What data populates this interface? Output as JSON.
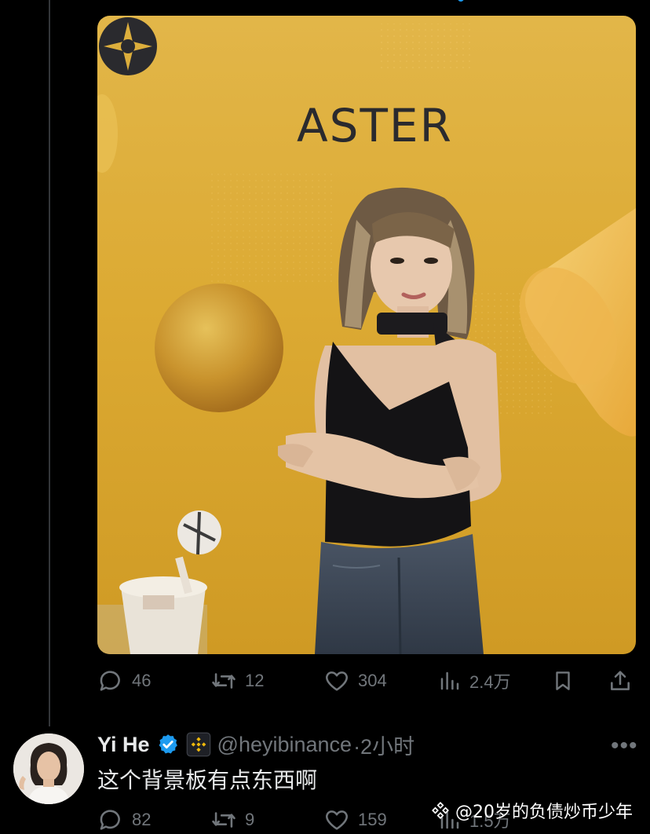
{
  "post": {
    "image_brand_text": "ASTER",
    "stats": {
      "replies": "46",
      "reposts": "12",
      "likes": "304",
      "views": "2.4万"
    }
  },
  "reply": {
    "name": "Yi He",
    "handle": "@heyibinance",
    "time": "·2小时",
    "text": "这个背景板有点东西啊",
    "stats": {
      "replies": "82",
      "reposts": "9",
      "likes": "159",
      "views": "1.5万"
    }
  },
  "watermark": "@20岁的负债炒币少年",
  "colors": {
    "background": "#000000",
    "muted": "#71767b",
    "text": "#e7e9ea",
    "verified": "#1d9bf0",
    "binance": "#f0b90b"
  },
  "icons": [
    "reply-icon",
    "repost-icon",
    "like-icon",
    "views-icon",
    "bookmark-icon",
    "share-icon",
    "verified-badge-icon",
    "binance-badge-icon",
    "more-icon"
  ]
}
